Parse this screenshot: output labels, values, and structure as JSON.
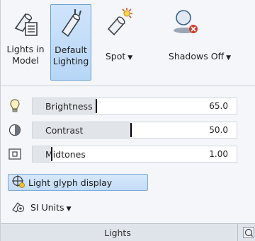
{
  "ribbon": {
    "buttons": [
      {
        "label_line1": "Lights in",
        "label_line2": "Model",
        "icon": "lights-in-model-icon"
      },
      {
        "label_line1": "Default",
        "label_line2": "Lighting",
        "icon": "default-lighting-icon",
        "active": true
      },
      {
        "label": "Spot",
        "icon": "spot-light-icon",
        "dropdown": "▼"
      },
      {
        "label": "Shadows Off",
        "icon": "shadows-off-icon",
        "dropdown": "▼"
      }
    ],
    "sliders": [
      {
        "label": "Brightness",
        "value": "65.0",
        "fraction": 0.31,
        "icon": "light-bulb-icon"
      },
      {
        "label": "Contrast",
        "value": "50.0",
        "fraction": 0.48,
        "icon": "contrast-icon"
      },
      {
        "label": "Midtones",
        "value": "1.00",
        "fraction": 0.09,
        "icon": "midtones-icon"
      }
    ],
    "glyph_button": {
      "label": "Light glyph display",
      "icon": "light-glyph-icon"
    },
    "units": {
      "label": "SI Units",
      "dropdown": "▼",
      "icon": "units-icon"
    },
    "footer": {
      "title": "Lights"
    }
  },
  "colors": {
    "accent": "#6b9fd6",
    "active_bg": "#c3dcf6",
    "red_x": "#d23a2a",
    "bulb_yellow": "#f2d84a"
  }
}
